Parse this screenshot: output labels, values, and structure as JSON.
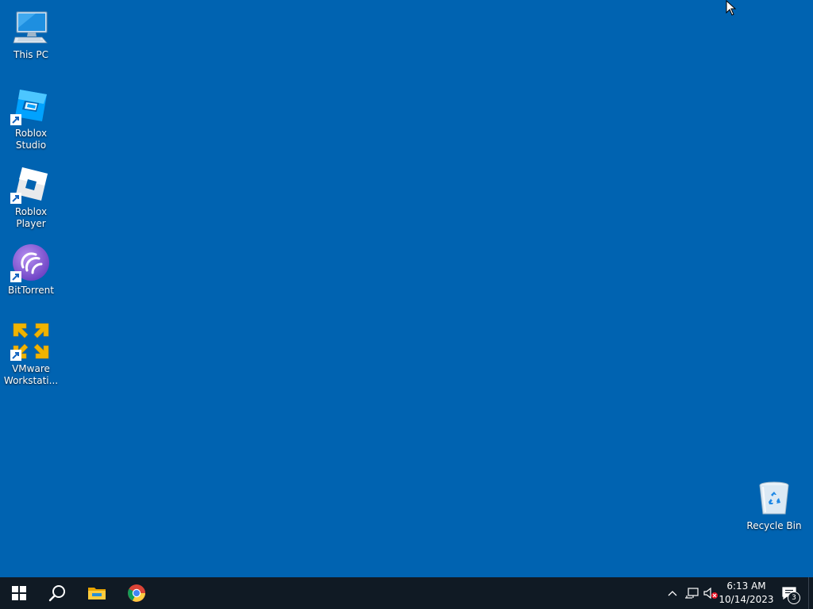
{
  "desktop": {
    "background_color": "#0063b1",
    "icons": [
      {
        "label": "This PC",
        "icon": "this-pc-icon"
      },
      {
        "label": "Roblox Studio",
        "icon": "roblox-studio-icon"
      },
      {
        "label": "Roblox Player",
        "icon": "roblox-player-icon"
      },
      {
        "label": "BitTorrent",
        "icon": "bittorrent-icon"
      },
      {
        "label": "VMware Workstati...",
        "icon": "vmware-icon"
      },
      {
        "label": "Recycle Bin",
        "icon": "recycle-bin-icon"
      }
    ]
  },
  "taskbar": {
    "background_color": "#101a24",
    "pinned": [
      {
        "name": "start",
        "icon": "windows-logo-icon"
      },
      {
        "name": "search",
        "icon": "search-icon"
      },
      {
        "name": "file-explorer",
        "icon": "folder-icon"
      },
      {
        "name": "chrome",
        "icon": "chrome-icon"
      }
    ],
    "tray": {
      "icons": [
        "chevron-up-icon",
        "network-icon",
        "volume-muted-icon"
      ],
      "time": "6:13 AM",
      "date": "10/14/2023",
      "notification_count": "3"
    }
  }
}
